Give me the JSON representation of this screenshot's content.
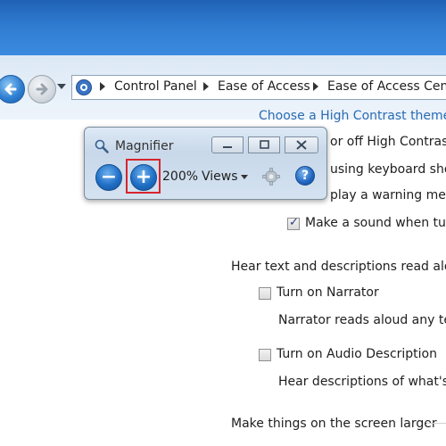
{
  "breadcrumb": {
    "items": [
      "Control Panel",
      "Ease of Access",
      "Ease of Access Cente"
    ]
  },
  "content": {
    "high_contrast_link": "Choose a High Contrast theme",
    "lines": [
      "or off High Contrast",
      "using keyboard short",
      "play a warning messa",
      "Make a sound when turn"
    ],
    "hear_section_title": "Hear text and descriptions read aloud",
    "narrator_label": "Turn on Narrator",
    "narrator_desc": "Narrator reads aloud any tex",
    "audio_desc_label": "Turn on Audio Description",
    "audio_desc_desc": "Hear descriptions of what's h",
    "larger_section_title": "Make things on the screen larger"
  },
  "checkboxes": {
    "make_sound_checked": true,
    "narrator_checked": false,
    "audio_desc_checked": false
  },
  "magnifier": {
    "title": "Magnifier",
    "zoom_level": "200%",
    "views_label": "Views",
    "zoom_out_symbol": "−",
    "zoom_in_symbol": "+",
    "help_symbol": "?",
    "highlighted_control": "zoom-in-button",
    "highlight_color": "#d6252c"
  },
  "icons": {
    "back": "back-arrow-icon",
    "forward": "forward-arrow-icon",
    "control_panel": "control-panel-icon",
    "magnifier": "magnifier-icon",
    "minimize": "minimize-icon",
    "restore": "restore-icon",
    "close": "close-icon",
    "options": "gear-icon",
    "help": "help-icon"
  },
  "colors": {
    "title_bar": "#2f7bd0",
    "link": "#2a6bb3",
    "accent_button": "#1f6fc6"
  }
}
